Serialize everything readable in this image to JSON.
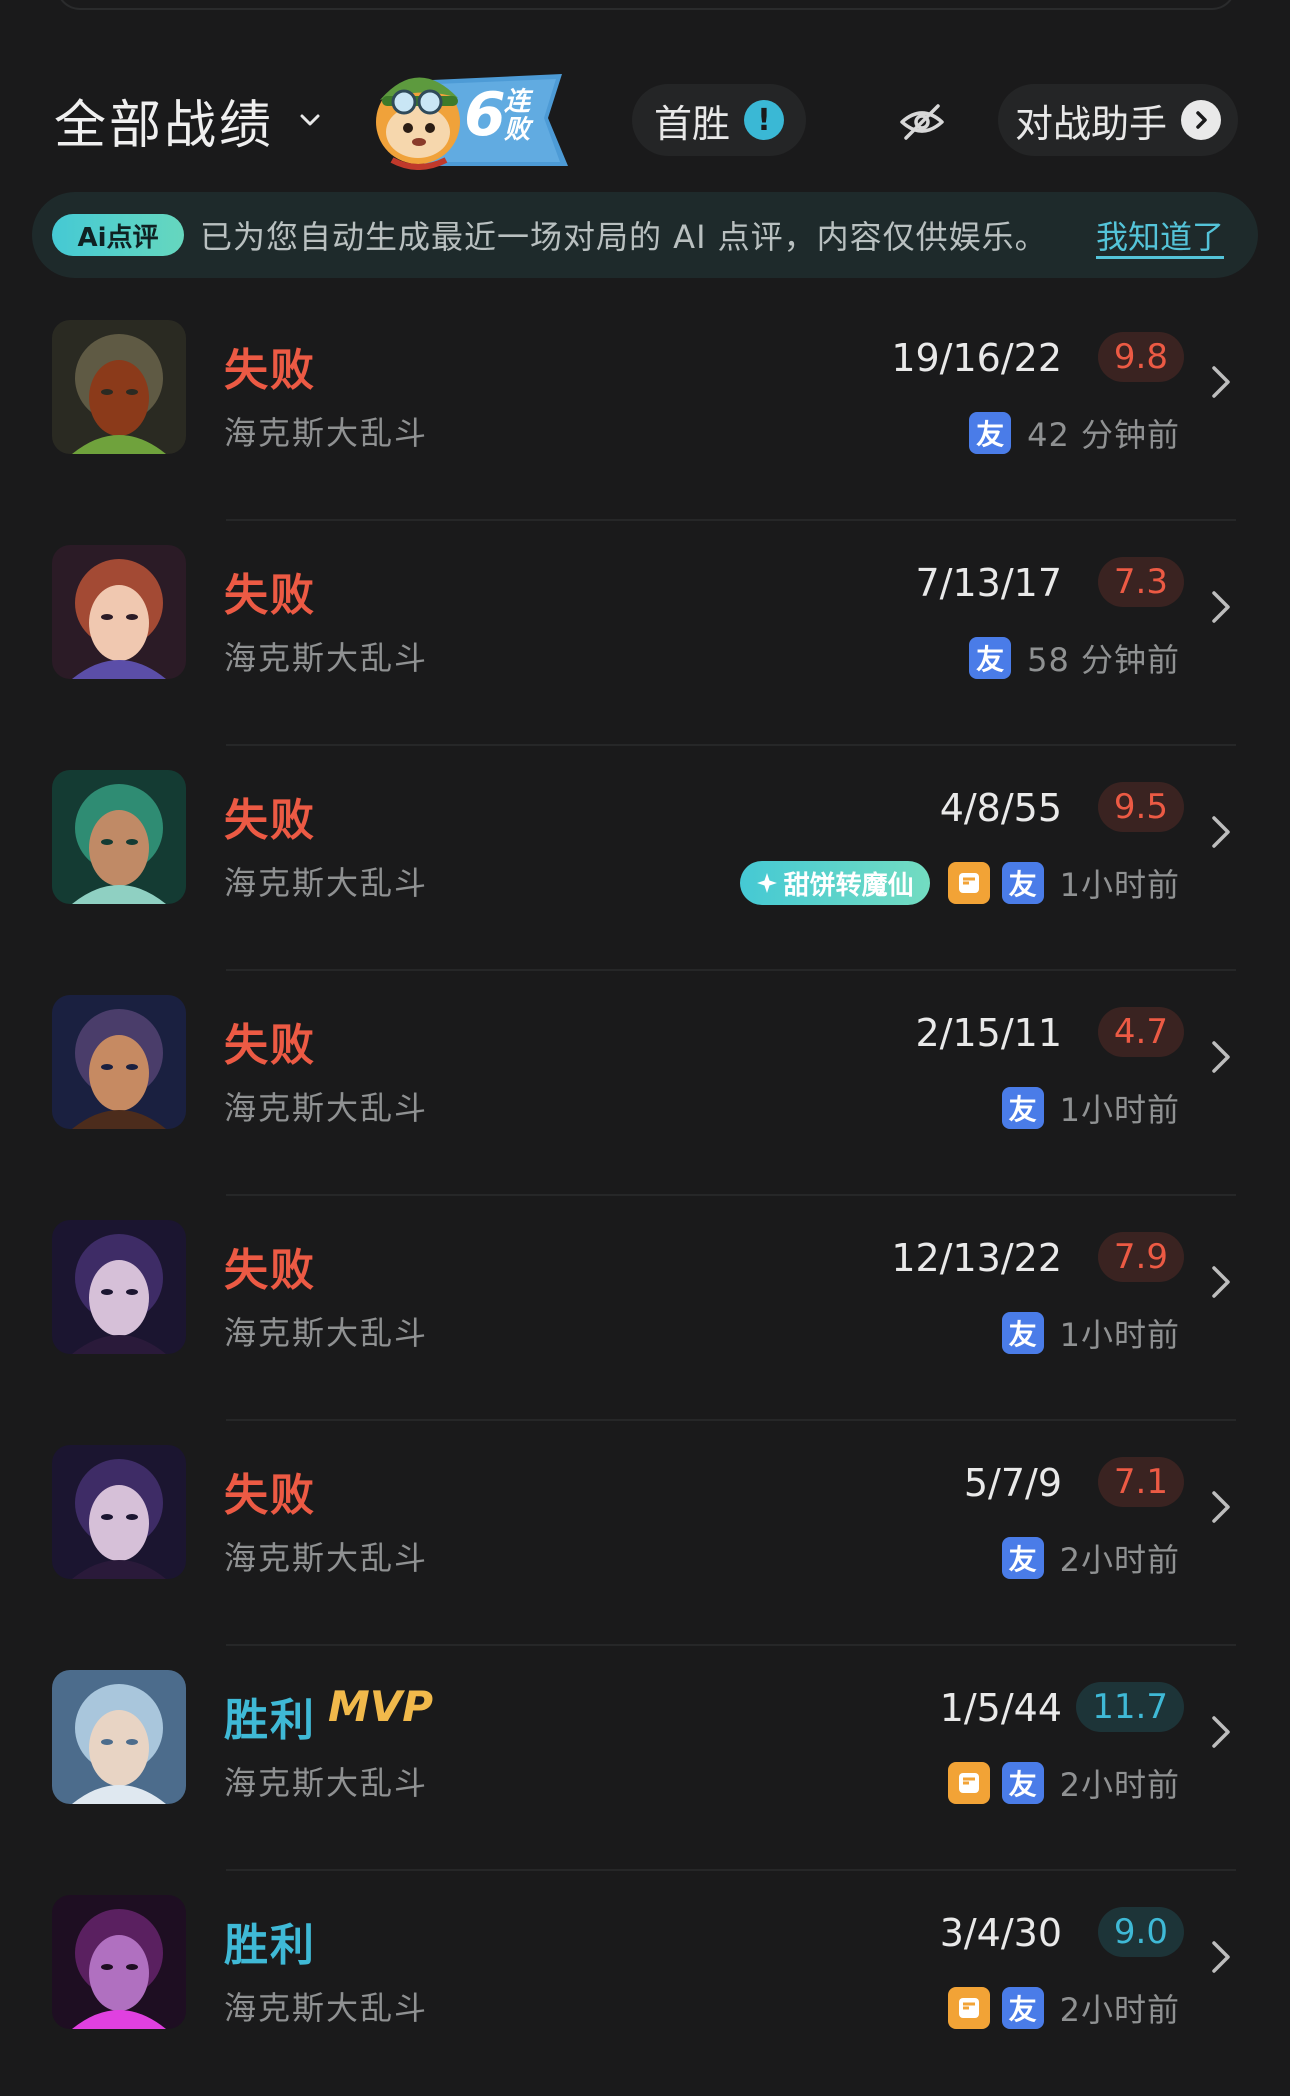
{
  "header": {
    "filter_label": "全部战绩",
    "streak_number": "6",
    "streak_chars": "连败",
    "first_win_label": "首胜",
    "first_win_badge": "!",
    "helper_label": "对战助手"
  },
  "ai_banner": {
    "tag": "Ai点评",
    "text": "已为您自动生成最近一场对局的 AI 点评，内容仅供娱乐。",
    "ack": "我知道了"
  },
  "colors": {
    "loss": "#ec5a44",
    "win": "#3fb9d6",
    "mvp": "#f1b94b",
    "friend_tag": "#4a7ce8",
    "orange_tag": "#f2a336"
  },
  "matches": [
    {
      "result": "失败",
      "mode": "海克斯大乱斗",
      "kda": "19/16/22",
      "score": "9.8",
      "time": "42 分钟前",
      "friend": "友",
      "avatar": "champion-portrait-1"
    },
    {
      "result": "失败",
      "mode": "海克斯大乱斗",
      "kda": "7/13/17",
      "score": "7.3",
      "time": "58 分钟前",
      "friend": "友",
      "avatar": "champion-portrait-2"
    },
    {
      "result": "失败",
      "mode": "海克斯大乱斗",
      "kda": "4/8/55",
      "score": "9.5",
      "time": "1小时前",
      "friend": "友",
      "special_tag": "甜饼转魔仙",
      "avatar": "champion-portrait-3"
    },
    {
      "result": "失败",
      "mode": "海克斯大乱斗",
      "kda": "2/15/11",
      "score": "4.7",
      "time": "1小时前",
      "friend": "友",
      "avatar": "champion-portrait-4"
    },
    {
      "result": "失败",
      "mode": "海克斯大乱斗",
      "kda": "12/13/22",
      "score": "7.9",
      "time": "1小时前",
      "friend": "友",
      "avatar": "champion-portrait-5"
    },
    {
      "result": "失败",
      "mode": "海克斯大乱斗",
      "kda": "5/7/9",
      "score": "7.1",
      "time": "2小时前",
      "friend": "友",
      "avatar": "champion-portrait-5"
    },
    {
      "result": "胜利",
      "mvp": "MVP",
      "mode": "海克斯大乱斗",
      "kda": "1/5/44",
      "score": "11.7",
      "time": "2小时前",
      "friend": "友",
      "avatar": "champion-portrait-6"
    },
    {
      "result": "胜利",
      "mode": "海克斯大乱斗",
      "kda": "3/4/30",
      "score": "9.0",
      "time": "2小时前",
      "friend": "友",
      "avatar": "champion-portrait-7"
    }
  ]
}
